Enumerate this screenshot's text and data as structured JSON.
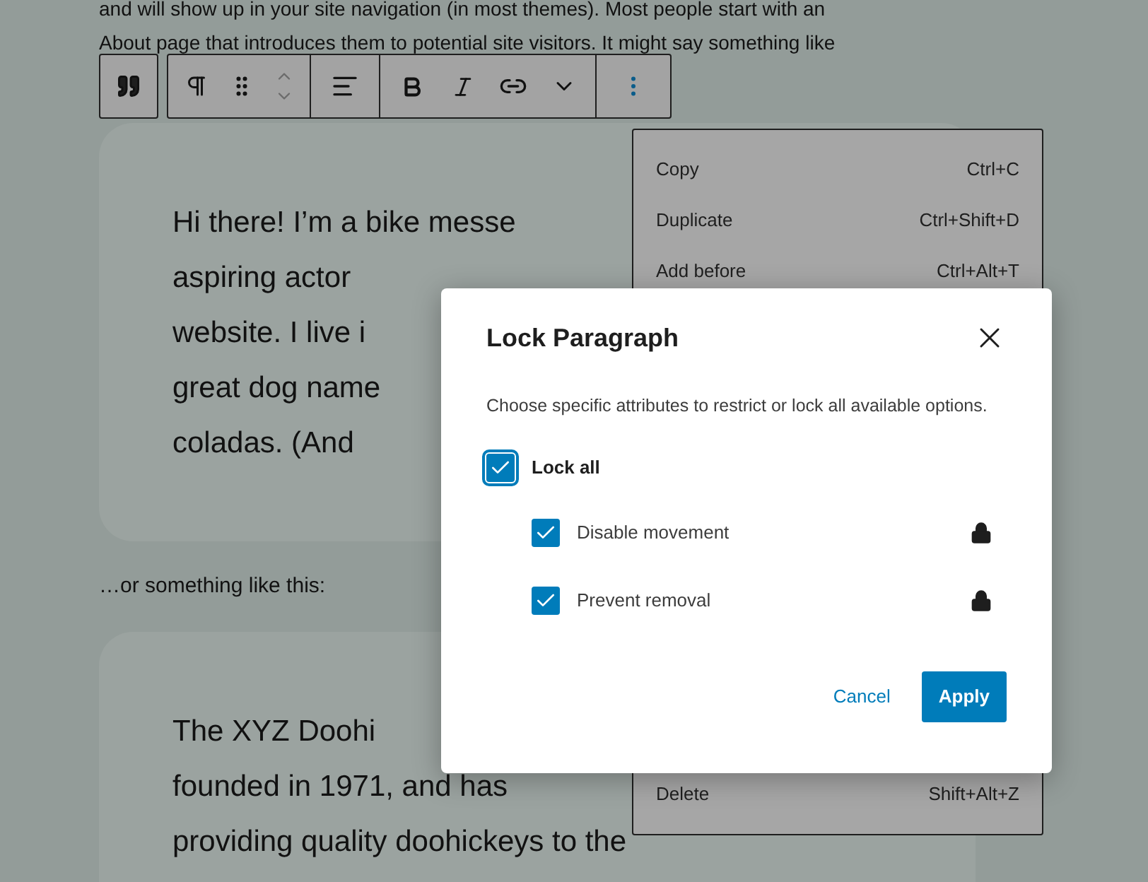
{
  "intro_lines": [
    "and will show up in your site navigation (in most themes). Most people start with an",
    "About page that introduces them to potential site visitors. It might say something like"
  ],
  "blocks": [
    {
      "kind": "card",
      "lines": [
        "Hi there! I’m a bike messe",
        "aspiring actor",
        "website. I live i",
        "great dog name",
        "coladas. (And"
      ]
    },
    {
      "kind": "text",
      "text": "…or something like this:"
    },
    {
      "kind": "card",
      "lines": [
        "The XYZ Doohi",
        "founded in 1971, and has",
        "providing quality doohickeys to the"
      ]
    }
  ],
  "block_menu": {
    "items": [
      {
        "label": "Copy",
        "shortcut": "Ctrl+C"
      },
      {
        "label": "Duplicate",
        "shortcut": "Ctrl+Shift+D"
      },
      {
        "label": "Add before",
        "shortcut": "Ctrl+Alt+T"
      }
    ],
    "bottom_items": [
      {
        "label": "Delete",
        "shortcut": "Shift+Alt+Z"
      }
    ]
  },
  "dialog": {
    "title": "Lock Paragraph",
    "description": "Choose specific attributes to restrict or lock all available options.",
    "lock_all": {
      "label": "Lock all",
      "checked": true,
      "focused": true
    },
    "options": [
      {
        "label": "Disable movement",
        "checked": true
      },
      {
        "label": "Prevent removal",
        "checked": true
      }
    ],
    "buttons": [
      {
        "kind": "link",
        "label": "Cancel"
      },
      {
        "kind": "primary",
        "label": "Apply"
      }
    ]
  }
}
